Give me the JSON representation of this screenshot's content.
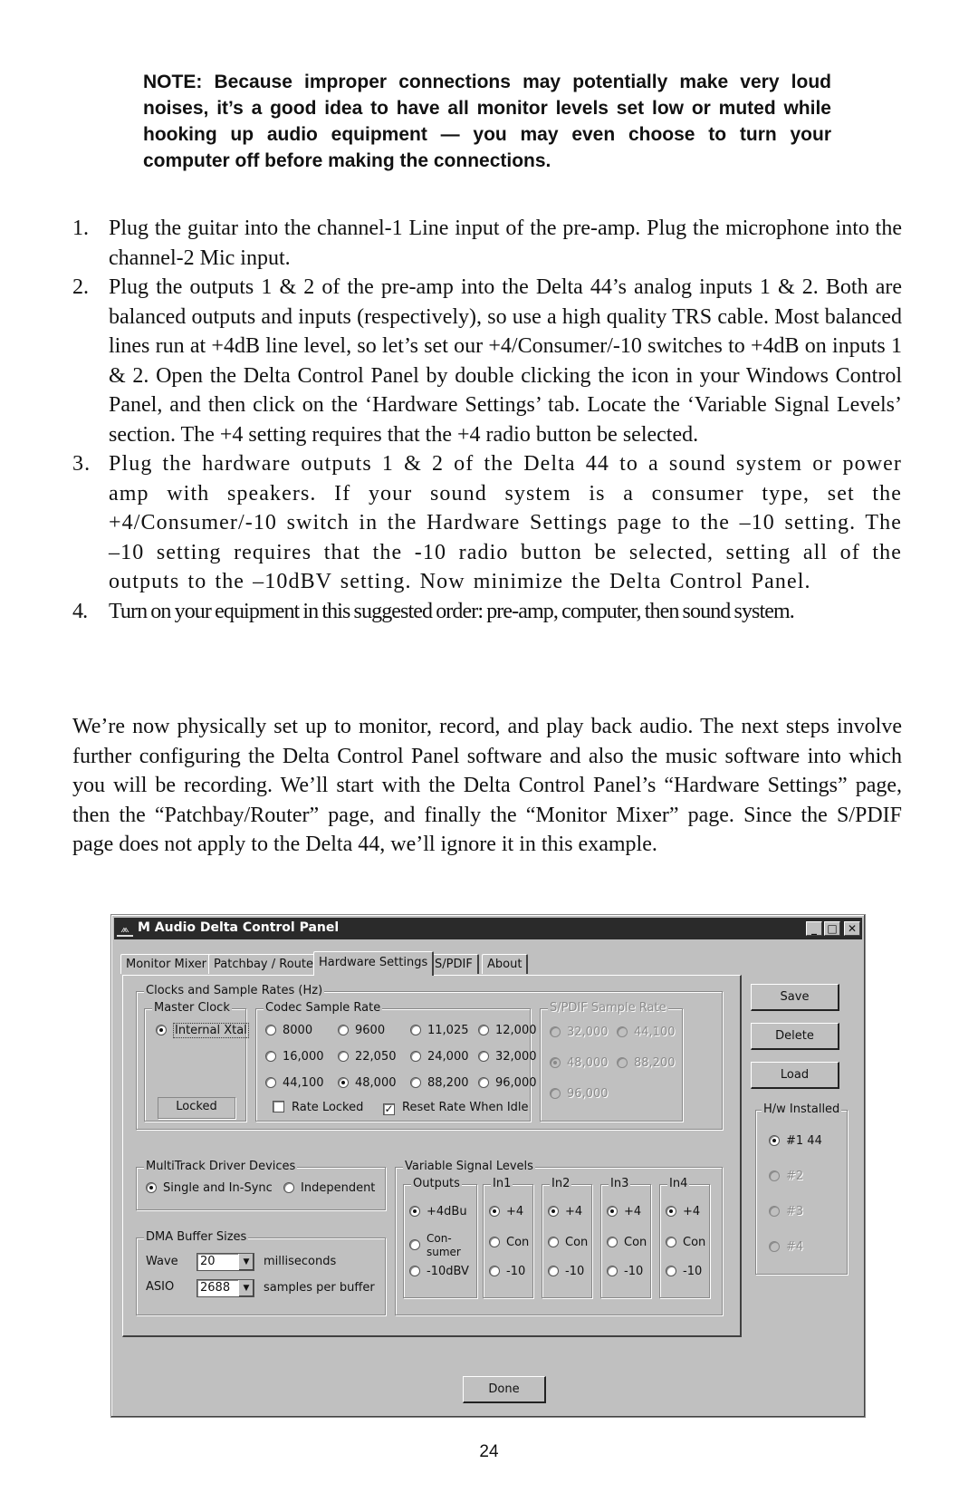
{
  "note": "NOTE: Because improper connections may potentially make very loud noises, it’s a good idea to have all monitor levels set low or muted while hooking up audio equipment — you may even choose to turn your computer off before making the connections.",
  "steps": [
    {
      "num": "1.",
      "text": "Plug the guitar into the channel-1 Line input of the pre-amp.  Plug the microphone into the channel-2 Mic input."
    },
    {
      "num": "2.",
      "text": "Plug the outputs 1 & 2 of the pre-amp into the Delta 44’s analog inputs 1 & 2.  Both are balanced outputs and inputs (respectively), so use a high quality TRS cable.  Most balanced lines run at +4dB line level, so let’s set our +4/Consumer/-10 switches to +4dB on inputs 1 & 2.  Open the Delta Control Panel by double clicking the icon in your Windows Control Panel, and then click on the ‘Hardware Settings’ tab.  Locate the ‘Variable Signal Levels’ section.  The +4 setting requires that the +4 radio button be selected."
    },
    {
      "num": "3.",
      "text": "Plug the hardware outputs 1 & 2 of the Delta 44 to a sound system or power amp with speakers.  If your sound system is a consumer type, set the +4/Consumer/-10 switch in the Hardware Settings page to the –10 setting.  The –10 setting requires that the -10 radio button be selected, setting all of the outputs to the –10dBV setting.  Now minimize the Delta Control Panel."
    },
    {
      "num": "4.",
      "text": "Turn on your equipment in this suggested order: pre-amp, computer, then sound system."
    }
  ],
  "paragraph": "We’re now physically set up to monitor, record, and play back audio.  The next steps involve further configuring the Delta Control Panel software and also the music software into which you will be recording.  We’ll start with the Delta Control Panel’s “Hardware Settings” page, then the “Patchbay/Router” page, and finally the “Monitor Mixer” page.  Since the S/PDIF page does not apply to the Delta 44, we’ll ignore it in this  example.",
  "page_number": "24",
  "window": {
    "title": "M Audio Delta Control Panel",
    "app_icon": "m-audio-logo-icon",
    "controls": {
      "minimize": "_",
      "maximize": "□",
      "close": "✕"
    },
    "tabs": [
      {
        "label": "Monitor Mixer",
        "active": false
      },
      {
        "label": "Patchbay / Router",
        "active": false
      },
      {
        "label": "Hardware Settings",
        "active": true
      },
      {
        "label": "S/PDIF",
        "active": false
      },
      {
        "label": "About",
        "active": false
      }
    ],
    "clocks_group": {
      "label": "Clocks and Sample Rates (Hz)",
      "master_clock": {
        "label": "Master Clock",
        "option": "Internal Xtal",
        "selected": true,
        "locked_label": "Locked"
      },
      "codec_rate": {
        "label": "Codec Sample Rate",
        "options": [
          "8000",
          "9600",
          "11,025",
          "12,000",
          "16,000",
          "22,050",
          "24,000",
          "32,000",
          "44,100",
          "48,000",
          "88,200",
          "96,000"
        ],
        "selected": "48,000",
        "rate_locked": {
          "label": "Rate Locked",
          "checked": false
        },
        "reset_rate": {
          "label": "Reset Rate When Idle",
          "checked": true
        }
      },
      "spdif_rate": {
        "label": "S/PDIF Sample Rate",
        "options": [
          "32,000",
          "44,100",
          "48,000",
          "88,200",
          "96,000"
        ],
        "selected": "48,000",
        "disabled": true
      }
    },
    "multitrack": {
      "label": "MultiTrack Driver Devices",
      "options": [
        "Single and In-Sync",
        "Independent"
      ],
      "selected": "Single and In-Sync"
    },
    "dma": {
      "label": "DMA Buffer Sizes",
      "wave": {
        "label": "Wave",
        "value": "20",
        "unit": "milliseconds"
      },
      "asio": {
        "label": "ASIO",
        "value": "2688",
        "unit": "samples per buffer"
      }
    },
    "signal_levels": {
      "label": "Variable Signal Levels",
      "outputs": {
        "label": "Outputs",
        "options": [
          "+4dBu",
          "Con- sumer",
          "-10dBV"
        ],
        "selected": "+4dBu"
      },
      "inputs": [
        {
          "label": "In1",
          "options": [
            "+4",
            "Con",
            "-10"
          ],
          "selected": "+4"
        },
        {
          "label": "In2",
          "options": [
            "+4",
            "Con",
            "-10"
          ],
          "selected": "+4"
        },
        {
          "label": "In3",
          "options": [
            "+4",
            "Con",
            "-10"
          ],
          "selected": "+4"
        },
        {
          "label": "In4",
          "options": [
            "+4",
            "Con",
            "-10"
          ],
          "selected": "+4"
        }
      ]
    },
    "buttons": {
      "save": "Save",
      "delete": "Delete",
      "load": "Load",
      "done": "Done"
    },
    "hw_installed": {
      "label": "H/w Installed",
      "options": [
        {
          "label": "#1 44",
          "selected": true,
          "enabled": true
        },
        {
          "label": "#2",
          "selected": false,
          "enabled": false
        },
        {
          "label": "#3",
          "selected": false,
          "enabled": false
        },
        {
          "label": "#4",
          "selected": false,
          "enabled": false
        }
      ]
    }
  }
}
